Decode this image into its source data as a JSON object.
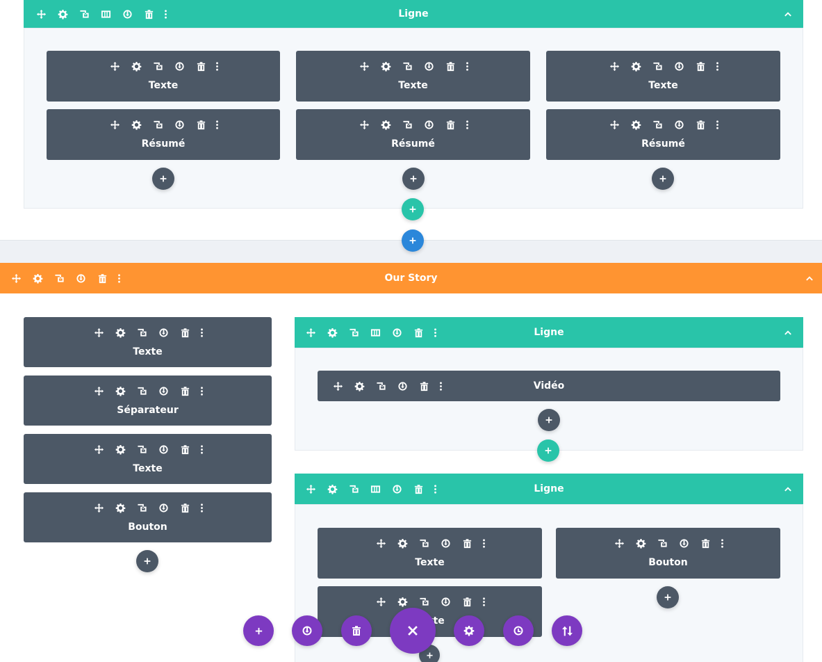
{
  "colors": {
    "row_green": "#29c4a9",
    "section_orange": "#ff9431",
    "module_dark": "#4c5866",
    "add_blue": "#2b87da",
    "bottom_purple": "#7d3ac1"
  },
  "top_row": {
    "title": "Ligne",
    "modules": [
      {
        "label": "Texte"
      },
      {
        "label": "Texte"
      },
      {
        "label": "Texte"
      },
      {
        "label": "Résumé"
      },
      {
        "label": "Résumé"
      },
      {
        "label": "Résumé"
      }
    ]
  },
  "section": {
    "title": "Our Story"
  },
  "left_column": {
    "modules": [
      {
        "label": "Texte"
      },
      {
        "label": "Séparateur"
      },
      {
        "label": "Texte"
      },
      {
        "label": "Bouton"
      }
    ]
  },
  "row_video": {
    "title": "Ligne",
    "module": {
      "label": "Vidéo"
    }
  },
  "row_bottom": {
    "title": "Ligne",
    "modules": [
      {
        "label": "Texte"
      },
      {
        "label": "Bouton"
      },
      {
        "label": "Texte"
      }
    ]
  },
  "icons": {
    "move": "move-icon",
    "settings": "gear-icon",
    "duplicate": "duplicate-icon",
    "columns": "columns-icon",
    "save": "power-icon",
    "delete": "trash-icon",
    "more": "dots-icon",
    "collapse": "chevron-up-icon",
    "add": "plus-icon",
    "close": "close-icon",
    "history": "history-icon",
    "portability": "portability-icon"
  }
}
